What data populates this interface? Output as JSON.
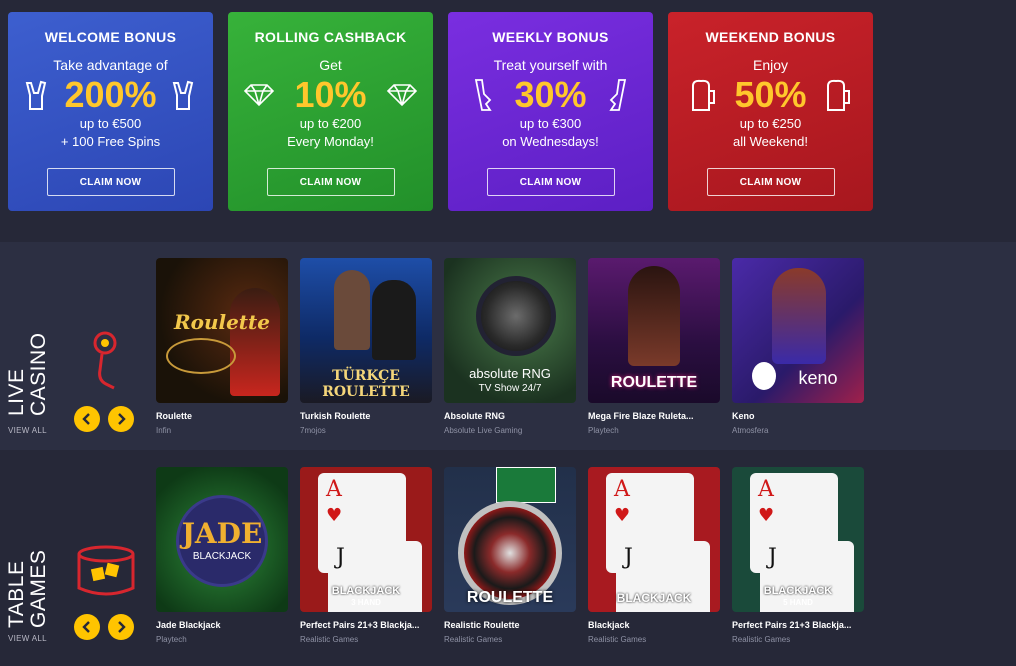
{
  "bonuses": [
    {
      "title": "WELCOME BONUS",
      "sub": "Take advantage of",
      "pct": "200%",
      "line1": "up to €500",
      "line2": "+ 100 Free Spins",
      "cta": "CLAIM NOW",
      "icon": "rock-hand-icon"
    },
    {
      "title": "ROLLING CASHBACK",
      "sub": "Get",
      "pct": "10%",
      "line1": "up to €200",
      "line2": "Every Monday!",
      "cta": "CLAIM NOW",
      "icon": "diamond-icon"
    },
    {
      "title": "WEEKLY BONUS",
      "sub": "Treat yourself with",
      "pct": "30%",
      "line1": "up to €300",
      "line2": "on Wednesdays!",
      "cta": "CLAIM NOW",
      "icon": "pistol-icon"
    },
    {
      "title": "WEEKEND BONUS",
      "sub": "Enjoy",
      "pct": "50%",
      "line1": "up to €250",
      "line2": "all Weekend!",
      "cta": "CLAIM NOW",
      "icon": "beer-mug-icon"
    }
  ],
  "live_casino": {
    "label_line1": "LIVE",
    "label_line2": "CASINO",
    "view_all": "VIEW ALL",
    "games": [
      {
        "title": "Roulette",
        "provider": "Infin",
        "art_text": "Roulette"
      },
      {
        "title": "Turkish Roulette",
        "provider": "7mojos",
        "art_text": "TÜRKÇE ROULETTE"
      },
      {
        "title": "Absolute RNG",
        "provider": "Absolute Live Gaming",
        "art_text": "absolute RNG",
        "art_sub": "TV Show 24/7"
      },
      {
        "title": "Mega Fire Blaze Ruleta...",
        "provider": "Playtech",
        "art_text": "ROULETTE"
      },
      {
        "title": "Keno",
        "provider": "Atmosfera",
        "art_text": "keno"
      }
    ]
  },
  "table_games": {
    "label_line1": "TABLE",
    "label_line2": "GAMES",
    "view_all": "VIEW ALL",
    "games": [
      {
        "title": "Jade Blackjack",
        "provider": "Playtech",
        "art_text": "JADE",
        "art_sub": "BLACKJACK"
      },
      {
        "title": "Perfect Pairs 21+3 Blackja...",
        "provider": "Realistic Games",
        "art_text": "BLACKJACK",
        "art_sub": "3 HAND"
      },
      {
        "title": "Realistic Roulette",
        "provider": "Realistic Games",
        "art_text": "ROULETTE"
      },
      {
        "title": "Blackjack",
        "provider": "Realistic Games",
        "art_text": "BLACKJACK"
      },
      {
        "title": "Perfect Pairs 21+3 Blackja...",
        "provider": "Realistic Games",
        "art_text": "BLACKJACK",
        "art_sub": "5 HAND"
      }
    ]
  },
  "colors": {
    "accent": "#ffc72c",
    "background": "#262838",
    "welcome": "#3d5fcf",
    "cashback": "#37b23a",
    "weekly": "#7a2ee0",
    "weekend": "#c9222a"
  }
}
